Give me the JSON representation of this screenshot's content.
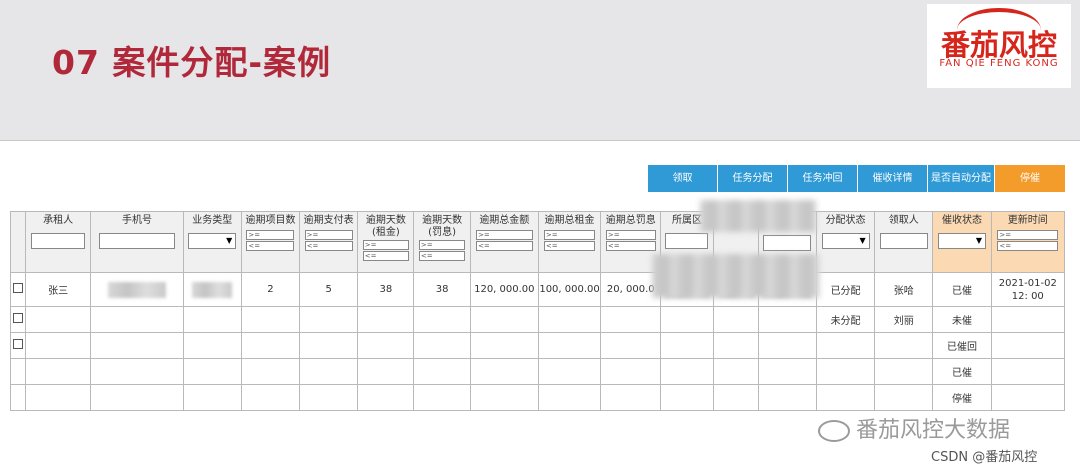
{
  "slide": {
    "title": "07 案件分配-案例"
  },
  "logo": {
    "main": "番茄风控",
    "sub": "FAN QIE FENG KONG"
  },
  "toolbar": {
    "buttons": [
      {
        "label": "领取"
      },
      {
        "label": "任务分配"
      },
      {
        "label": "任务冲回"
      },
      {
        "label": "催收详情"
      },
      {
        "label": "是否自动分配"
      },
      {
        "label": "停催"
      }
    ],
    "colors": {
      "primary": "#2f9ad6",
      "stop": "#f39b2b"
    }
  },
  "table": {
    "columns": [
      {
        "label": "",
        "filter": "none"
      },
      {
        "label": "承租人",
        "filter": "text"
      },
      {
        "label": "手机号",
        "filter": "text"
      },
      {
        "label": "业务类型",
        "filter": "select"
      },
      {
        "label": "逾期项目数",
        "filter": "range"
      },
      {
        "label": "逾期支付表",
        "filter": "range"
      },
      {
        "label": "逾期天数\n(租金)",
        "filter": "range"
      },
      {
        "label": "逾期天数\n(罚息)",
        "filter": "range"
      },
      {
        "label": "逾期总金额",
        "filter": "range"
      },
      {
        "label": "逾期总租金",
        "filter": "range"
      },
      {
        "label": "逾期总罚息",
        "filter": "range"
      },
      {
        "label": "所属区",
        "filter": "text"
      },
      {
        "label": "",
        "filter": "blurred"
      },
      {
        "label": "",
        "filter": "blurred"
      },
      {
        "label": "分配状态",
        "filter": "select"
      },
      {
        "label": "领取人",
        "filter": "text"
      },
      {
        "label": "催收状态",
        "filter": "select"
      },
      {
        "label": "更新时间",
        "filter": "range"
      }
    ],
    "range_ge": ">=",
    "range_le": "<=",
    "rows": [
      [
        "",
        "张三",
        "",
        "",
        "2",
        "5",
        "38",
        "38",
        "120, 000.00",
        "100, 000.00",
        "20, 000.0",
        "",
        "",
        "",
        "已分配",
        "张哈",
        "已催",
        "2021-01-02\n12: 00"
      ],
      [
        "",
        "",
        "",
        "",
        "",
        "",
        "",
        "",
        "",
        "",
        "",
        "",
        "",
        "",
        "未分配",
        "刘丽",
        "未催",
        ""
      ],
      [
        "",
        "",
        "",
        "",
        "",
        "",
        "",
        "",
        "",
        "",
        "",
        "",
        "",
        "",
        "",
        "",
        "已催回",
        ""
      ],
      [
        "",
        "",
        "",
        "",
        "",
        "",
        "",
        "",
        "",
        "",
        "",
        "",
        "",
        "",
        "",
        "",
        "已催",
        ""
      ],
      [
        "",
        "",
        "",
        "",
        "",
        "",
        "",
        "",
        "",
        "",
        "",
        "",
        "",
        "",
        "",
        "",
        "停催",
        ""
      ]
    ],
    "highlight_color": "#fbd9b3"
  },
  "watermark": {
    "text": "番茄风控大数据"
  },
  "credit": {
    "text": "CSDN @番茄风控"
  }
}
